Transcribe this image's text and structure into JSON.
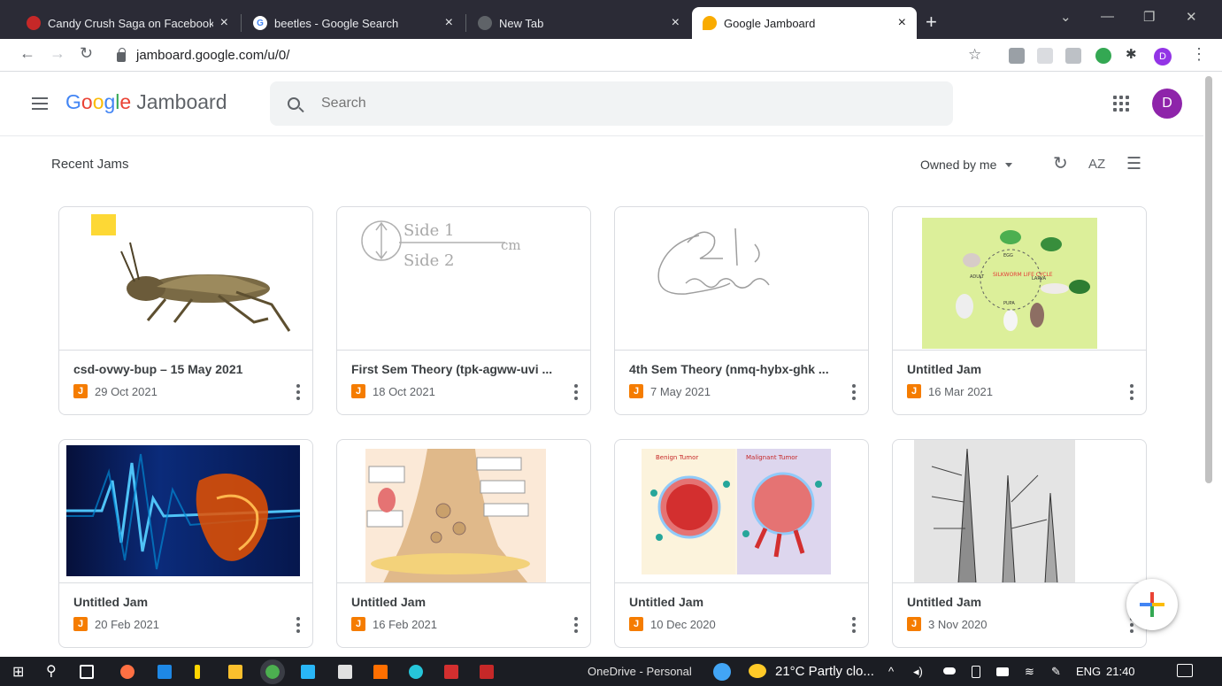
{
  "browser": {
    "tabs": [
      {
        "title": "Candy Crush Saga on Facebook",
        "icon": "candy-crush-icon",
        "color": "#c62828"
      },
      {
        "title": "beetles - Google Search",
        "icon": "google-icon",
        "color": "#4285f4"
      },
      {
        "title": "New Tab",
        "icon": "chrome-icon",
        "color": "#5f6368"
      },
      {
        "title": "Google Jamboard",
        "icon": "jamboard-icon",
        "color": "#f9ab00",
        "active": true
      }
    ],
    "new_tab": "+",
    "url": "jamboard.google.com/u/0/",
    "profile_initial": "D"
  },
  "app": {
    "name_parts": [
      "G",
      "o",
      "o",
      "g",
      "l",
      "e"
    ],
    "product": "Jamboard",
    "search_placeholder": "Search",
    "avatar_initial": "D"
  },
  "section": {
    "title": "Recent Jams",
    "filter": "Owned by me"
  },
  "jams": [
    {
      "title": "csd-ovwy-bup – 15 May 2021",
      "date": "29 Oct 2021",
      "thumb": "grasshopper"
    },
    {
      "title": "First Sem Theory (tpk-agww-uvi ...",
      "date": "18 Oct 2021",
      "thumb": "handwriting-side"
    },
    {
      "title": "4th Sem Theory (nmq-hybx-ghk ...",
      "date": "7 May 2021",
      "thumb": "handwriting-scribble"
    },
    {
      "title": "Untitled Jam",
      "date": "16 Mar 2021",
      "thumb": "silkworm-lifecycle"
    },
    {
      "title": "Untitled Jam",
      "date": "20 Feb 2021",
      "thumb": "heart-ecg"
    },
    {
      "title": "Untitled Jam",
      "date": "16 Feb 2021",
      "thumb": "synapse-diagram"
    },
    {
      "title": "Untitled Jam",
      "date": "10 Dec 2020",
      "thumb": "tumor-diagram"
    },
    {
      "title": "Untitled Jam",
      "date": "3 Nov 2020",
      "thumb": "plant-section"
    }
  ],
  "thumb_text": {
    "side1": "Side 1",
    "side2": "Side 2",
    "cm": "cm",
    "lifecycle": "SILKWORM LIFE CYCLE",
    "adult": "ADULT",
    "larva": "LARVA",
    "pupa": "PUPA",
    "egg": "EGG",
    "benign": "Benign Tumor",
    "malignant": "Malignant Tumor"
  },
  "taskbar": {
    "onedrive": "OneDrive - Personal",
    "weather": "21°C  Partly clo...",
    "lang": "ENG",
    "time": "21:40"
  }
}
